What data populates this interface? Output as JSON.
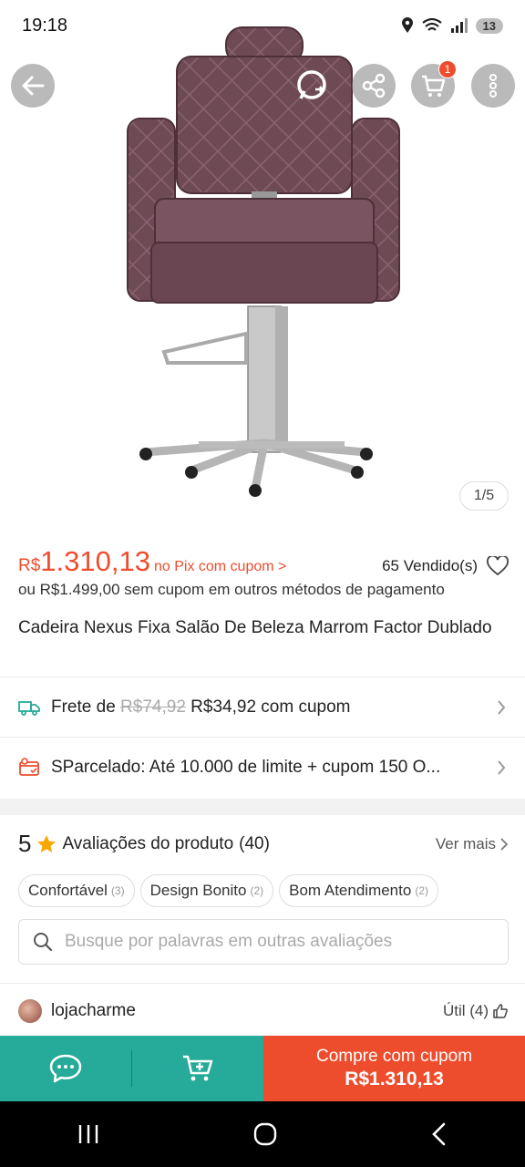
{
  "status": {
    "time": "19:18",
    "battery": "13"
  },
  "gallery": {
    "counter": "1/5",
    "cart_count": "1"
  },
  "price": {
    "currency": "R$",
    "value": "1.310,13",
    "note": "no Pix com cupom >",
    "sold": "65 Vendido(s)",
    "alt": "ou R$1.499,00 sem cupom em outros métodos de pagamento"
  },
  "product": {
    "title": "Cadeira Nexus Fixa Salão De Beleza Marrom Factor Dublado"
  },
  "shipping": {
    "label": "Frete de",
    "old_price": "R$74,92",
    "new_price": "R$34,92 com cupom"
  },
  "installments": {
    "text": "SParcelado: Até 10.000 de limite + cupom 150 O..."
  },
  "reviews": {
    "rating": "5",
    "title": "Avaliações do produto",
    "count": "(40)",
    "see_more": "Ver mais",
    "chips": [
      {
        "label": "Confortável",
        "count": "(3)"
      },
      {
        "label": "Design Bonito",
        "count": "(2)"
      },
      {
        "label": "Bom Atendimento",
        "count": "(2)"
      }
    ],
    "search_placeholder": "Busque por palavras em outras avaliações",
    "first_reviewer": {
      "name": "lojacharme",
      "useful": "Útil (4)"
    }
  },
  "bottom": {
    "buy_label": "Compre com cupom",
    "buy_price": "R$1.310,13"
  },
  "colors": {
    "accent": "#ee4d2d",
    "teal": "#26aa99",
    "star": "#f6a700"
  },
  "icons": [
    "back-arrow-icon",
    "whatsapp-icon",
    "share-icon",
    "cart-icon",
    "more-icon",
    "truck-icon",
    "installment-icon",
    "star-icon",
    "search-icon",
    "chat-icon",
    "add-to-cart-icon",
    "thumbs-up-icon",
    "heart-icon"
  ]
}
